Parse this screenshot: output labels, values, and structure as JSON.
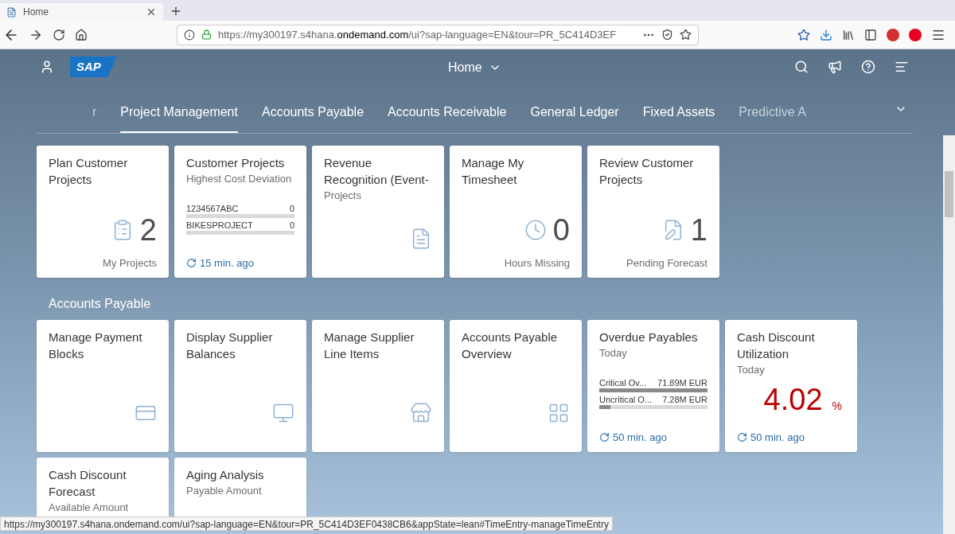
{
  "browser": {
    "tab_title": "Home",
    "url": [
      "https://my300197.s4hana.",
      "ondemand.com",
      "/ui?sap-language=EN&tour=PR_5C414D3EF"
    ],
    "status_url": "https://my300197.s4hana.ondemand.com/ui?sap-language=EN&tour=PR_5C414D3EF0438CB6&appState=lean#TimeEntry-manageTimeEntry"
  },
  "shell": {
    "logo": "SAP",
    "title": "Home"
  },
  "tabs": [
    {
      "label": "r",
      "selected": false,
      "faded": true
    },
    {
      "label": "Project Management",
      "selected": true,
      "faded": false
    },
    {
      "label": "Accounts Payable",
      "selected": false,
      "faded": false
    },
    {
      "label": "Accounts Receivable",
      "selected": false,
      "faded": false
    },
    {
      "label": "General Ledger",
      "selected": false,
      "faded": false
    },
    {
      "label": "Fixed Assets",
      "selected": false,
      "faded": false
    },
    {
      "label": "Predictive A",
      "selected": false,
      "faded": true
    }
  ],
  "sections": [
    {
      "tiles": [
        {
          "kind": "numeric",
          "title": "Plan Customer Projects",
          "number": "2",
          "footer": "My Projects"
        },
        {
          "kind": "comparison",
          "title": "Customer Projects",
          "subtitle": "Highest Cost Deviation",
          "bars": [
            {
              "label": "1234567ABC",
              "value": "0",
              "level": 0
            },
            {
              "label": "BIKESPROJECT",
              "value": "0",
              "level": 0
            }
          ],
          "refresh": "15 min. ago"
        },
        {
          "kind": "launch",
          "title": "Revenue Recognition (Event-",
          "subtitle": "Projects"
        },
        {
          "kind": "numeric",
          "title": "Manage My Timesheet",
          "number": "0",
          "footer": "Hours Missing"
        },
        {
          "kind": "numeric",
          "title": "Review Customer Projects",
          "number": "1",
          "footer": "Pending Forecast"
        }
      ]
    },
    {
      "title": "Accounts Payable",
      "tiles": [
        {
          "kind": "launch",
          "title": "Manage Payment Blocks"
        },
        {
          "kind": "launch",
          "title": "Display Supplier Balances"
        },
        {
          "kind": "launch",
          "title": "Manage Supplier Line Items"
        },
        {
          "kind": "launch",
          "title": "Accounts Payable Overview"
        },
        {
          "kind": "comparison",
          "title": "Overdue Payables",
          "subtitle": "Today",
          "bars": [
            {
              "label": "Critical Ov...",
              "value": "71.89M EUR",
              "level": 1
            },
            {
              "label": "Uncritical O...",
              "value": "7.28M EUR",
              "level": 0.1
            }
          ],
          "refresh": "50 min. ago"
        },
        {
          "kind": "kpi",
          "title": "Cash Discount Utilization",
          "subtitle": "Today",
          "value": "4.02",
          "unit": "%",
          "refresh": "50 min. ago"
        },
        {
          "kind": "launch",
          "title": "Cash Discount Forecast",
          "subtitle": "Available Amount"
        },
        {
          "kind": "launch",
          "title": "Aging Analysis",
          "subtitle": "Payable Amount"
        }
      ]
    }
  ]
}
